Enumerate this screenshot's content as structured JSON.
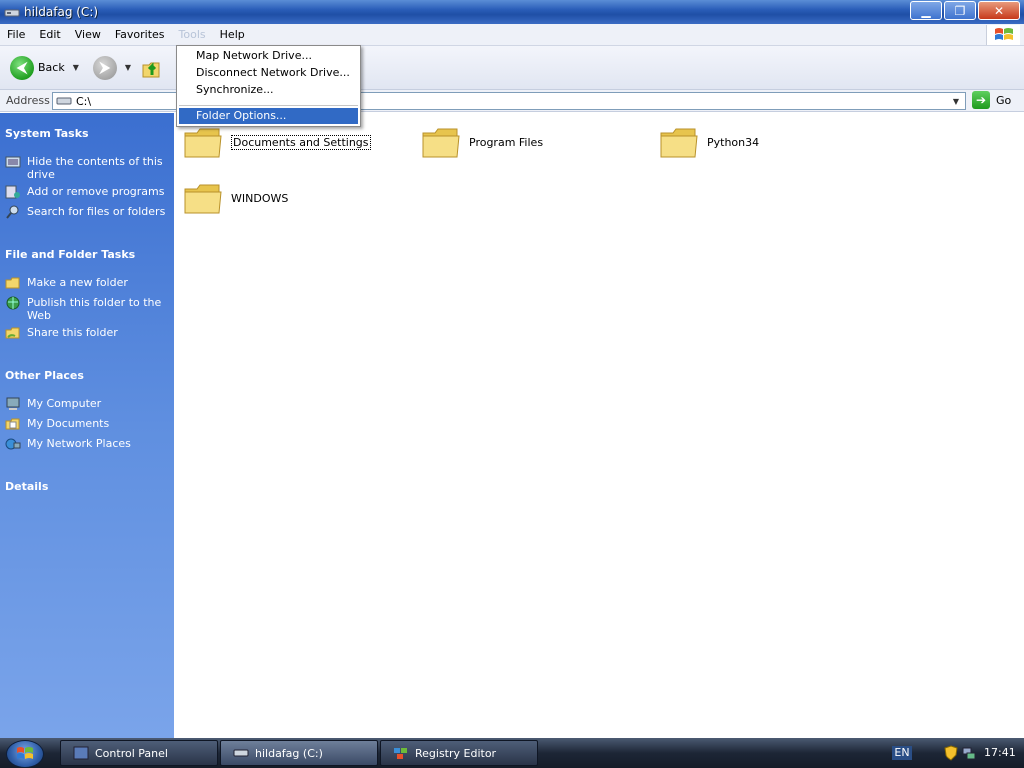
{
  "window": {
    "title": "hildafag (C:)"
  },
  "menubar": {
    "items": [
      "File",
      "Edit",
      "View",
      "Favorites",
      "Tools",
      "Help"
    ]
  },
  "toolbar": {
    "back_label": "Back"
  },
  "address": {
    "label": "Address",
    "value": "C:\\",
    "go_label": "Go"
  },
  "tools_menu": {
    "items": [
      "Map Network Drive...",
      "Disconnect Network Drive...",
      "Synchronize...",
      "Folder Options..."
    ],
    "highlighted": "Folder Options..."
  },
  "left_pane": {
    "system_tasks": {
      "title": "System Tasks",
      "items": [
        "Hide the contents of this drive",
        "Add or remove programs",
        "Search for files or folders"
      ]
    },
    "file_folder_tasks": {
      "title": "File and Folder Tasks",
      "items": [
        "Make a new folder",
        "Publish this folder to the Web",
        "Share this folder"
      ]
    },
    "other_places": {
      "title": "Other Places",
      "items": [
        "My Computer",
        "My Documents",
        "My Network Places"
      ]
    },
    "details": {
      "title": "Details"
    }
  },
  "content": {
    "folders": [
      "Documents and Settings",
      "Program Files",
      "Python34",
      "WINDOWS"
    ],
    "selected": "Documents and Settings"
  },
  "taskbar": {
    "buttons": [
      "Control Panel",
      "hildafag (C:)",
      "Registry Editor"
    ],
    "active": "hildafag (C:)",
    "language": "EN",
    "clock": "17:41"
  },
  "colors": {
    "title_blue": "#2a5db8",
    "pane_blue": "#3b6fd0",
    "menu_highlight": "#316ac5",
    "folder_yellow": "#f2d66b"
  }
}
